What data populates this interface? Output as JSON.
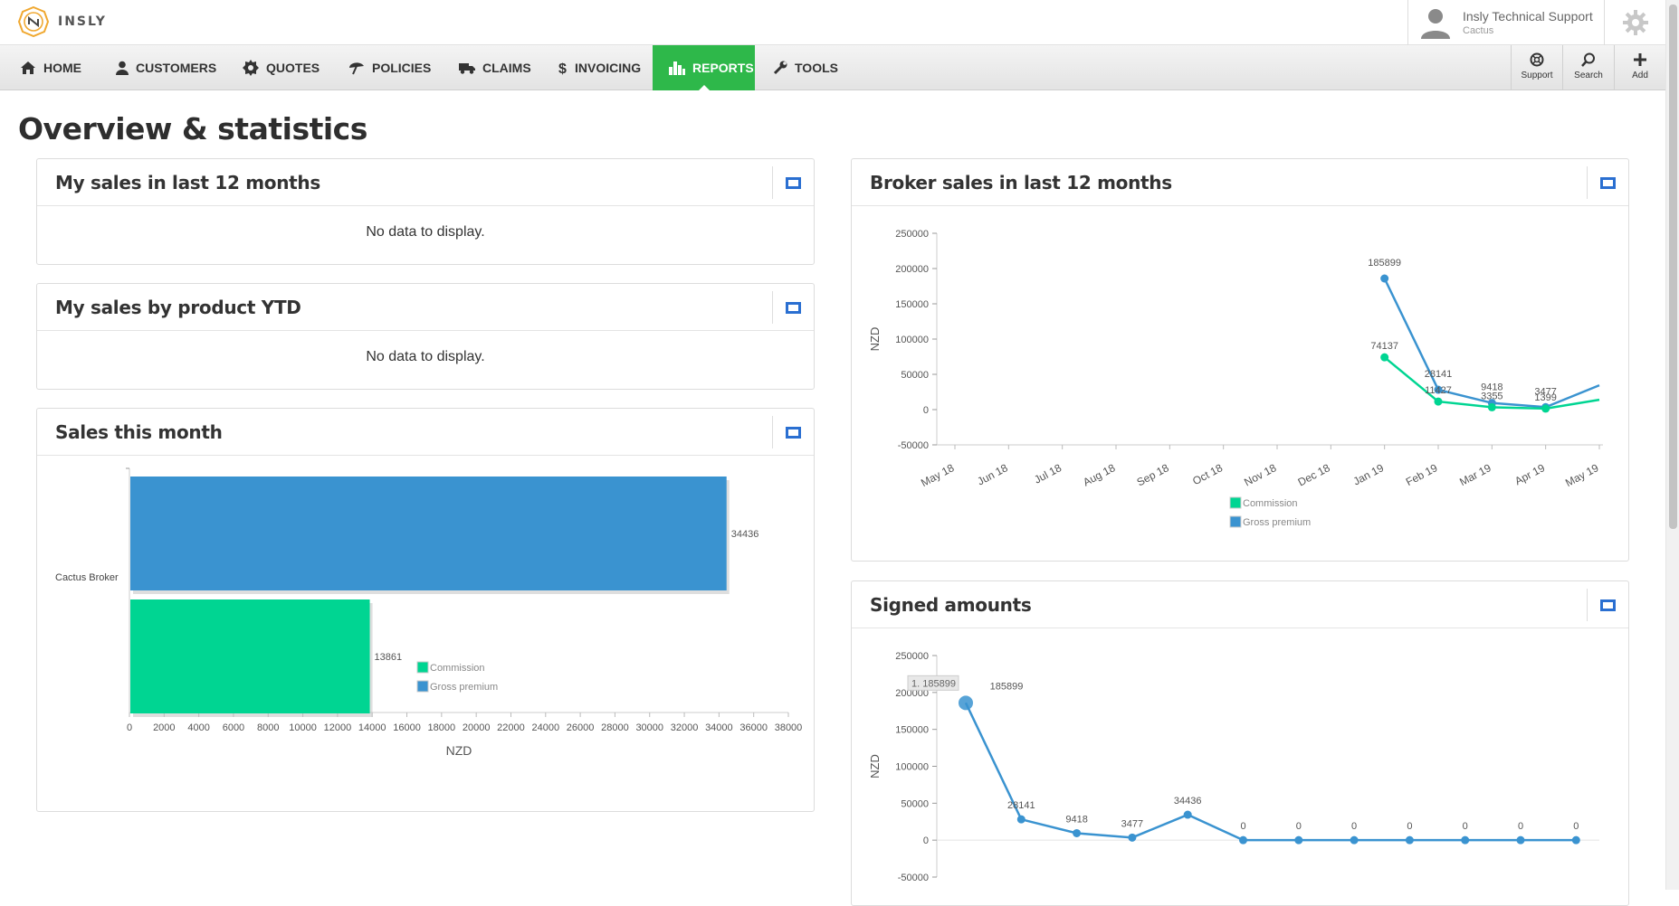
{
  "brand": {
    "name": "INSLY"
  },
  "user": {
    "name": "Insly Technical Support",
    "org": "Cactus"
  },
  "nav": {
    "items": [
      {
        "label": "HOME",
        "icon": "home-icon"
      },
      {
        "label": "CUSTOMERS",
        "icon": "user-icon"
      },
      {
        "label": "QUOTES",
        "icon": "badge-icon"
      },
      {
        "label": "POLICIES",
        "icon": "umbrella-icon"
      },
      {
        "label": "CLAIMS",
        "icon": "truck-icon"
      },
      {
        "label": "INVOICING",
        "icon": "dollar-icon"
      },
      {
        "label": "REPORTS",
        "icon": "bar-chart-icon",
        "active": true
      },
      {
        "label": "TOOLS",
        "icon": "wrench-icon"
      }
    ],
    "right_tools": [
      {
        "label": "Support",
        "icon": "lifebuoy-icon"
      },
      {
        "label": "Search",
        "icon": "search-icon"
      },
      {
        "label": "Add",
        "icon": "plus-icon"
      }
    ]
  },
  "page": {
    "title": "Overview & statistics"
  },
  "panels": {
    "my_sales": {
      "title": "My sales in last 12 months",
      "empty_text": "No data to display."
    },
    "by_product": {
      "title": "My sales by product YTD",
      "empty_text": "No data to display."
    },
    "sales_month": {
      "title": "Sales this month"
    },
    "broker_sales": {
      "title": "Broker sales in last 12 months"
    },
    "signed": {
      "title": "Signed amounts"
    }
  },
  "colors": {
    "commission": "#00d592",
    "gross": "#3a93d0",
    "active_nav": "#2eb84a",
    "accent": "#2a6fd1"
  },
  "chart_data": [
    {
      "id": "sales_this_month",
      "type": "bar",
      "orientation": "horizontal",
      "categories": [
        "Cactus Broker"
      ],
      "series": [
        {
          "name": "Gross premium",
          "values": [
            34436
          ]
        },
        {
          "name": "Commission",
          "values": [
            13861
          ]
        }
      ],
      "xlabel": "NZD",
      "xlim": [
        0,
        38000
      ],
      "xticks": [
        "0",
        "2000",
        "4000",
        "6000",
        "8000",
        "10000",
        "12000",
        "14000",
        "16000",
        "18000",
        "20000",
        "22000",
        "24000",
        "26000",
        "28000",
        "30000",
        "32000",
        "34000",
        "36000",
        "38000"
      ],
      "data_labels": [
        "34436",
        "13861"
      ],
      "legend": [
        "Commission",
        "Gross premium"
      ]
    },
    {
      "id": "broker_sales",
      "type": "line",
      "categories": [
        "May 18",
        "Jun 18",
        "Jul 18",
        "Aug 18",
        "Sep 18",
        "Oct 18",
        "Nov 18",
        "Dec 18",
        "Jan 19",
        "Feb 19",
        "Mar 19",
        "Apr 19",
        "May 19"
      ],
      "series": [
        {
          "name": "Commission",
          "values": [
            null,
            null,
            null,
            null,
            null,
            null,
            null,
            null,
            74137,
            11427,
            3355,
            1399,
            14000
          ]
        },
        {
          "name": "Gross premium",
          "values": [
            null,
            null,
            null,
            null,
            null,
            null,
            null,
            null,
            185899,
            28141,
            9418,
            3477,
            34436
          ]
        }
      ],
      "data_labels": [
        {
          "series": 0,
          "points": [
            "74137",
            "11427",
            "3355",
            "1399"
          ]
        },
        {
          "series": 1,
          "points": [
            "185899",
            "28141",
            "9418",
            "3477"
          ]
        }
      ],
      "ylabel": "NZD",
      "ylim": [
        -50000,
        250000
      ],
      "yticks": [
        "250000",
        "200000",
        "150000",
        "100000",
        "50000",
        "0",
        "-50000"
      ],
      "legend": [
        "Commission",
        "Gross premium"
      ]
    },
    {
      "id": "signed_amounts",
      "type": "line",
      "series": [
        {
          "name": "",
          "values": [
            185899,
            28141,
            9418,
            3477,
            34436,
            0,
            0,
            0,
            0,
            0,
            0,
            0
          ]
        }
      ],
      "data_labels": [
        "185899",
        "28141",
        "9418",
        "3477",
        "34436",
        "0",
        "0",
        "0",
        "0",
        "0",
        "0",
        "0"
      ],
      "tooltip": "1. 185899",
      "ylabel": "NZD",
      "ylim": [
        -50000,
        250000
      ],
      "yticks": [
        "250000",
        "200000",
        "150000",
        "100000",
        "50000",
        "0",
        "-50000"
      ]
    }
  ]
}
